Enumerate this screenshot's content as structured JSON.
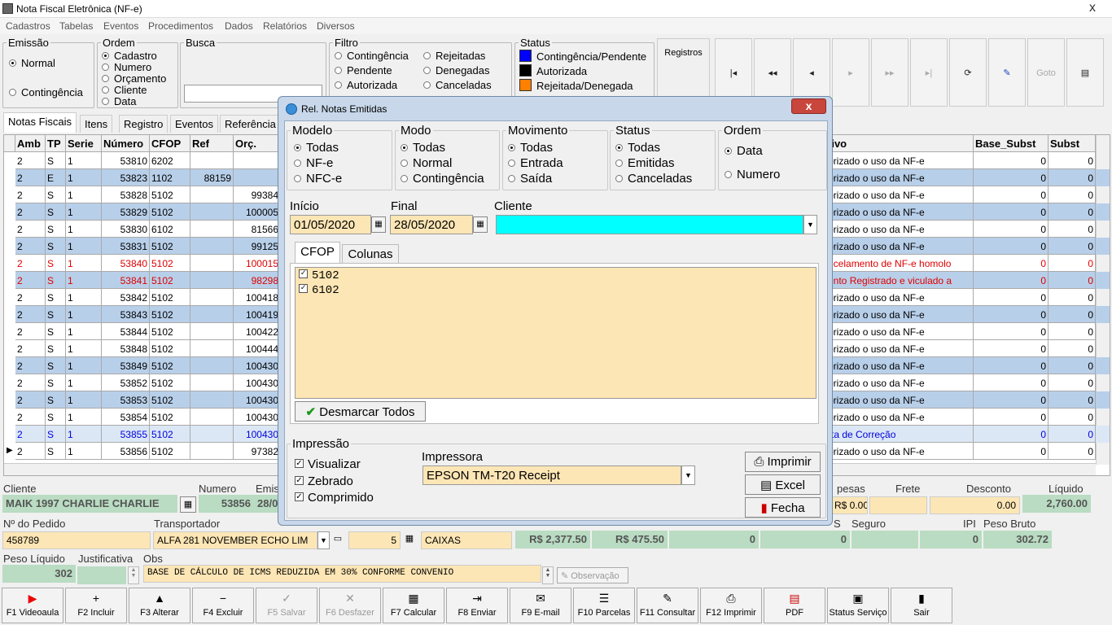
{
  "window": {
    "title": "Nota Fiscal Eletrônica (NF-e)",
    "close": "x"
  },
  "menu": [
    "Cadastros",
    "Tabelas",
    "Eventos",
    "Procedimentos",
    "Dados",
    "Relatórios",
    "Diversos"
  ],
  "emissao": {
    "legend": "Emissão",
    "opts": [
      "Normal",
      "Contingência"
    ]
  },
  "ordem": {
    "legend": "Ordem",
    "opts": [
      "Cadastro",
      "Numero",
      "Orçamento",
      "Cliente",
      "Data"
    ]
  },
  "busca": {
    "legend": "Busca",
    "value": ""
  },
  "filtro": {
    "legend": "Filtro",
    "col1": [
      "Contingência",
      "Pendente",
      "Autorizada"
    ],
    "col2": [
      "Rejeitadas",
      "Denegadas",
      "Canceladas"
    ]
  },
  "status": {
    "legend": "Status",
    "items": [
      {
        "label": "Contingência/Pendente",
        "color": "#0000ff"
      },
      {
        "label": "Autorizada",
        "color": "#000000"
      },
      {
        "label": "Rejeitada/Denegada",
        "color": "#ff8000"
      }
    ]
  },
  "registros": "Registros",
  "nav": [
    "|◂",
    "◂◂",
    "◂",
    "▸",
    "▸▸",
    "▸|",
    "⟳",
    "✎",
    "Goto",
    "▤"
  ],
  "tabs": [
    "Notas Fiscais",
    "Itens",
    "Registro",
    "Eventos",
    "Referência"
  ],
  "grid": {
    "headers": [
      "Amb",
      "TP",
      "Serie",
      "Número",
      "CFOP",
      "Ref",
      "Orç.",
      "tivo",
      "Base_Subst",
      "Subst"
    ],
    "rows": [
      {
        "amb": "2",
        "tp": "S",
        "serie": "1",
        "num": "53810",
        "cfop": "6202",
        "ref": "",
        "orc": "",
        "tivo": "orizado o uso da NF-e",
        "base": "0",
        "subst": "0",
        "style": "white"
      },
      {
        "amb": "2",
        "tp": "E",
        "serie": "1",
        "num": "53823",
        "cfop": "1102",
        "ref": "88159",
        "orc": "",
        "tivo": "orizado o uso da NF-e",
        "base": "0",
        "subst": "0",
        "style": "blue"
      },
      {
        "amb": "2",
        "tp": "S",
        "serie": "1",
        "num": "53828",
        "cfop": "5102",
        "ref": "",
        "orc": "99384",
        "tivo": "orizado o uso da NF-e",
        "base": "0",
        "subst": "0",
        "style": "white"
      },
      {
        "amb": "2",
        "tp": "S",
        "serie": "1",
        "num": "53829",
        "cfop": "5102",
        "ref": "",
        "orc": "100005",
        "tivo": "orizado o uso da NF-e",
        "base": "0",
        "subst": "0",
        "style": "blue"
      },
      {
        "amb": "2",
        "tp": "S",
        "serie": "1",
        "num": "53830",
        "cfop": "6102",
        "ref": "",
        "orc": "81566",
        "tivo": "orizado o uso da NF-e",
        "base": "0",
        "subst": "0",
        "style": "white"
      },
      {
        "amb": "2",
        "tp": "S",
        "serie": "1",
        "num": "53831",
        "cfop": "5102",
        "ref": "",
        "orc": "99125",
        "tivo": "orizado o uso da NF-e",
        "base": "0",
        "subst": "0",
        "style": "blue"
      },
      {
        "amb": "2",
        "tp": "S",
        "serie": "1",
        "num": "53840",
        "cfop": "5102",
        "ref": "",
        "orc": "100015",
        "tivo": "ncelamento de NF-e homolo",
        "base": "0",
        "subst": "0",
        "style": "red"
      },
      {
        "amb": "2",
        "tp": "S",
        "serie": "1",
        "num": "53841",
        "cfop": "5102",
        "ref": "",
        "orc": "98298",
        "tivo": "ento Registrado e viculado a",
        "base": "0",
        "subst": "0",
        "style": "redblue"
      },
      {
        "amb": "2",
        "tp": "S",
        "serie": "1",
        "num": "53842",
        "cfop": "5102",
        "ref": "",
        "orc": "100418",
        "tivo": "orizado o uso da NF-e",
        "base": "0",
        "subst": "0",
        "style": "white"
      },
      {
        "amb": "2",
        "tp": "S",
        "serie": "1",
        "num": "53843",
        "cfop": "5102",
        "ref": "",
        "orc": "100419",
        "tivo": "orizado o uso da NF-e",
        "base": "0",
        "subst": "0",
        "style": "blue"
      },
      {
        "amb": "2",
        "tp": "S",
        "serie": "1",
        "num": "53844",
        "cfop": "5102",
        "ref": "",
        "orc": "100422",
        "tivo": "orizado o uso da NF-e",
        "base": "0",
        "subst": "0",
        "style": "white"
      },
      {
        "amb": "2",
        "tp": "S",
        "serie": "1",
        "num": "53848",
        "cfop": "5102",
        "ref": "",
        "orc": "100444",
        "tivo": "orizado o uso da NF-e",
        "base": "0",
        "subst": "0",
        "style": "white"
      },
      {
        "amb": "2",
        "tp": "S",
        "serie": "1",
        "num": "53849",
        "cfop": "5102",
        "ref": "",
        "orc": "100430",
        "tivo": "orizado o uso da NF-e",
        "base": "0",
        "subst": "0",
        "style": "blue"
      },
      {
        "amb": "2",
        "tp": "S",
        "serie": "1",
        "num": "53852",
        "cfop": "5102",
        "ref": "",
        "orc": "100430",
        "tivo": "orizado o uso da NF-e",
        "base": "0",
        "subst": "0",
        "style": "white"
      },
      {
        "amb": "2",
        "tp": "S",
        "serie": "1",
        "num": "53853",
        "cfop": "5102",
        "ref": "",
        "orc": "100430",
        "tivo": "orizado o uso da NF-e",
        "base": "0",
        "subst": "0",
        "style": "blue"
      },
      {
        "amb": "2",
        "tp": "S",
        "serie": "1",
        "num": "53854",
        "cfop": "5102",
        "ref": "",
        "orc": "100430",
        "tivo": "orizado o uso da NF-e",
        "base": "0",
        "subst": "0",
        "style": "white"
      },
      {
        "amb": "2",
        "tp": "S",
        "serie": "1",
        "num": "53855",
        "cfop": "5102",
        "ref": "",
        "orc": "100430",
        "tivo": "rta de Correção",
        "base": "0",
        "subst": "0",
        "style": "bluetext"
      },
      {
        "amb": "2",
        "tp": "S",
        "serie": "1",
        "num": "53856",
        "cfop": "5102",
        "ref": "",
        "orc": "97382",
        "tivo": "orizado o uso da NF-e",
        "base": "0",
        "subst": "0",
        "style": "white"
      }
    ]
  },
  "form": {
    "cliente_lbl": "Cliente",
    "cliente": "MAIK 1997 CHARLIE CHARLIE",
    "numero_lbl": "Numero",
    "numero": "53856",
    "emis_lbl": "Emis",
    "emis": "28/0",
    "despesas_lbl": "pesas",
    "despesas": "R$ 0.00",
    "frete_lbl": "Frete",
    "frete": "",
    "desconto_lbl": "Desconto",
    "desconto": "0.00",
    "liquido_lbl": "Líquido",
    "liquido": "2,760.00",
    "pedido_lbl": "Nº do Pedido",
    "pedido": "458789",
    "transp_lbl": "Transportador",
    "transp": "ALFA 281 NOVEMBER ECHO LIM",
    "qtd": "5",
    "especie": "CAIXAS",
    "v1": "R$ 2,377.50",
    "v2": "R$ 475.50",
    "v3": "0",
    "v4": "0",
    "seguro_lbl": "Seguro",
    "s_lbl": "S",
    "ipi_lbl": "IPI",
    "ipi": "0",
    "pbruto_lbl": "Peso Bruto",
    "pbruto": "302.72",
    "pliq_lbl": "Peso Líquido",
    "pliq": "302",
    "justif_lbl": "Justificativa",
    "obs_lbl": "Obs",
    "obs": "BASE DE CÁLCULO DE ICMS REDUZIDA EM  30%  CONFORME  CONVENIO",
    "obs_btn": "Observação"
  },
  "fkeys": [
    {
      "label": "F1 Videoaula",
      "icon": "▶",
      "dis": false
    },
    {
      "label": "F2 Incluir",
      "icon": "+",
      "dis": false
    },
    {
      "label": "F3 Alterar",
      "icon": "▲",
      "dis": false
    },
    {
      "label": "F4 Excluir",
      "icon": "−",
      "dis": false
    },
    {
      "label": "F5 Salvar",
      "icon": "✓",
      "dis": true
    },
    {
      "label": "F6 Desfazer",
      "icon": "✕",
      "dis": true
    },
    {
      "label": "F7 Calcular",
      "icon": "▦",
      "dis": false
    },
    {
      "label": "F8 Enviar",
      "icon": "⇥",
      "dis": false
    },
    {
      "label": "F9 E-mail",
      "icon": "✉",
      "dis": false
    },
    {
      "label": "F10 Parcelas",
      "icon": "☰",
      "dis": false
    },
    {
      "label": "F11 Consultar",
      "icon": "✎",
      "dis": false
    },
    {
      "label": "F12 Imprimir",
      "icon": "⎙",
      "dis": false
    },
    {
      "label": "PDF",
      "icon": "▤",
      "dis": false
    },
    {
      "label": "Status Serviço",
      "icon": "▣",
      "dis": false
    },
    {
      "label": "Sair",
      "icon": "▮",
      "dis": false
    }
  ],
  "dialog": {
    "title": "Rel. Notas Emitidas",
    "close": "x",
    "modelo": {
      "legend": "Modelo",
      "opts": [
        "Todas",
        "NF-e",
        "NFC-e"
      ]
    },
    "modo": {
      "legend": "Modo",
      "opts": [
        "Todas",
        "Normal",
        "Contingência"
      ]
    },
    "movimento": {
      "legend": "Movimento",
      "opts": [
        "Todas",
        "Entrada",
        "Saída"
      ]
    },
    "status": {
      "legend": "Status",
      "opts": [
        "Todas",
        "Emitidas",
        "Canceladas"
      ]
    },
    "ordem": {
      "legend": "Ordem",
      "opts": [
        "Data",
        "Numero"
      ]
    },
    "inicio_lbl": "Início",
    "inicio": "01/05/2020",
    "final_lbl": "Final",
    "final": "28/05/2020",
    "cliente_lbl": "Cliente",
    "cliente": "",
    "tabs": [
      "CFOP",
      "Colunas"
    ],
    "cfops": [
      "5102",
      "6102"
    ],
    "desmarcar": "Desmarcar Todos",
    "impressao": {
      "legend": "Impressão",
      "opts": [
        "Visualizar",
        "Zebrado",
        "Comprimido"
      ]
    },
    "impressora_lbl": "Impressora",
    "impressora": "EPSON TM-T20 Receipt",
    "btn_imprimir": "Imprimir",
    "btn_excel": "Excel",
    "btn_fecha": "Fecha",
    "colors": {
      "cliente_bg": "#00ffff",
      "field_bg": "#fde6b5",
      "list_bg": "#fde6b5"
    }
  },
  "colors": {
    "row_blue": "#b8cfe9",
    "row_red_text": "#e00000",
    "row_blue_text": "#0000e0",
    "field": "#fde6b5",
    "green": "#b9dcc2"
  }
}
